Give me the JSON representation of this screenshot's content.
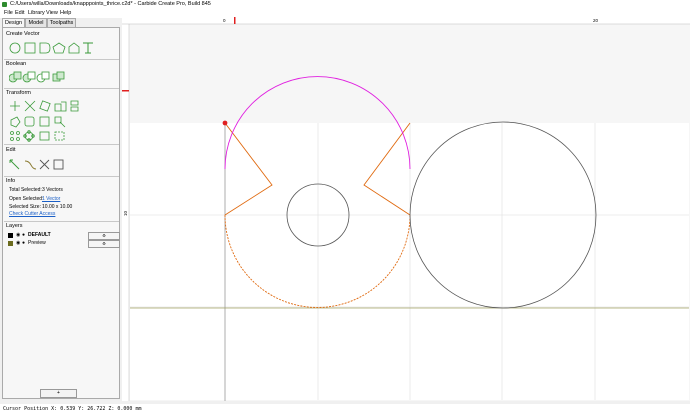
{
  "window": {
    "title": "C:/Users/willa/Downloads/knapppoints_thrice.c2d* - Carbide Create Pro, Build 845"
  },
  "menu": [
    "File",
    "Edit",
    "Library",
    "View",
    "Help"
  ],
  "tabs": [
    "Design",
    "Model",
    "Toolpaths"
  ],
  "sections": {
    "create_vector": "Create Vector",
    "boolean": "Boolean",
    "transform": "Transform",
    "edit": "Edit",
    "info": "Info",
    "layers": "Layers"
  },
  "info": {
    "total_selected_label": "Total Selected:",
    "total_selected_value": "3 Vectors",
    "open_selected_label": "Open Selected:",
    "open_selected_value": "1 Vector",
    "selected_size_label": "Selected Size:",
    "selected_size_value": "10.00 x 10.00",
    "check_link": "Check Cutter Access"
  },
  "layers": [
    {
      "name": "DEFAULT",
      "color": "#000000",
      "bold": true
    },
    {
      "name": "Preview",
      "color": "#6b6b1e",
      "bold": false
    }
  ],
  "add_layer_label": "+",
  "ruler": {
    "top_ticks": [
      "0",
      "20"
    ],
    "left_ticks": [
      "10"
    ]
  },
  "colors": {
    "selected": "#e06a10",
    "highlight": "#e020e0",
    "shape": "#555555",
    "axis_x": "#a0a060",
    "grid": "#dedede"
  },
  "status": "Cursor Position X: 0.539 Y: 26.722 Z: 0.000 mm"
}
